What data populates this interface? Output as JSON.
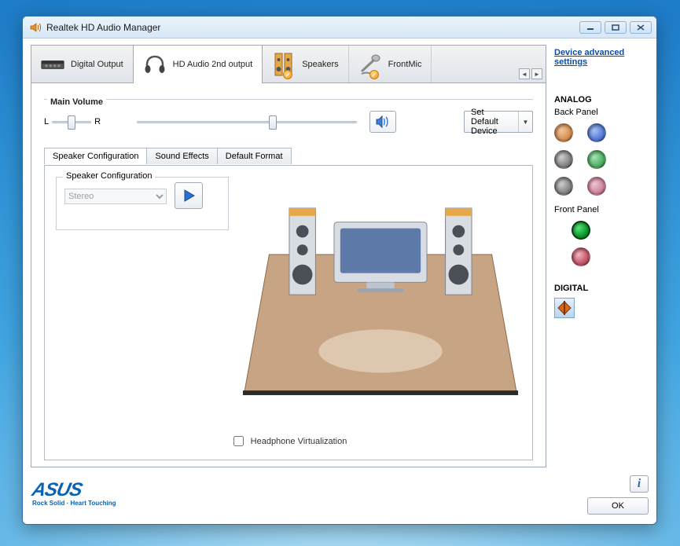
{
  "window": {
    "title": "Realtek HD Audio Manager"
  },
  "tabs": [
    {
      "label": "Digital Output",
      "icon": "amplifier"
    },
    {
      "label": "HD Audio 2nd output",
      "icon": "headphones",
      "active": true
    },
    {
      "label": "Speakers",
      "icon": "speakers",
      "badge": true
    },
    {
      "label": "FrontMic",
      "icon": "microphone",
      "badge": true
    }
  ],
  "advanced_link": "Device advanced settings",
  "volume": {
    "group_label": "Main Volume",
    "left": "L",
    "right": "R",
    "balance_pos": 0.5,
    "level_pos": 0.6,
    "default_btn": "Set Default Device"
  },
  "sub_tabs": [
    {
      "label": "Speaker Configuration",
      "active": true
    },
    {
      "label": "Sound Effects"
    },
    {
      "label": "Default Format"
    }
  ],
  "speaker_config": {
    "group_label": "Speaker Configuration",
    "selected": "Stereo"
  },
  "headphone_virtualization": {
    "label": "Headphone Virtualization",
    "checked": false
  },
  "side": {
    "analog_heading": "ANALOG",
    "back_panel_label": "Back Panel",
    "back_jacks": [
      "#d8935a",
      "#5a7fd8",
      "#888888",
      "#54b36a",
      "#888888",
      "#d187a0"
    ],
    "front_panel_label": "Front Panel",
    "front_jacks": [
      "#0a9a2b",
      "#c85a6e"
    ],
    "digital_heading": "DIGITAL",
    "digital_color": "#d5691e"
  },
  "footer": {
    "brand": "ASUS",
    "tagline": "Rock Solid · Heart Touching",
    "ok": "OK"
  }
}
